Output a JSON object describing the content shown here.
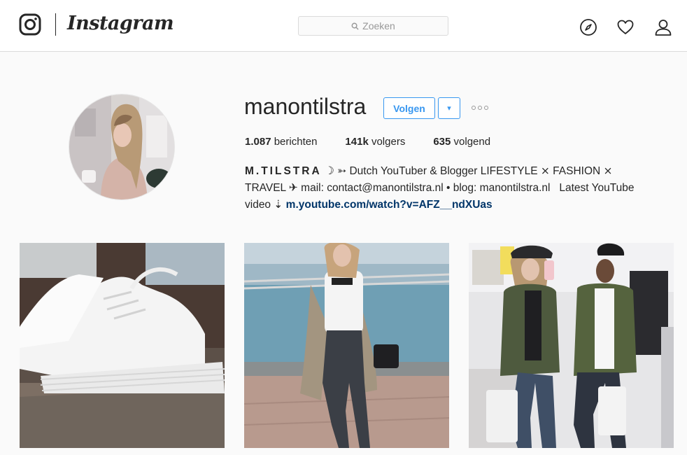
{
  "header": {
    "wordmark": "Instagram",
    "search": {
      "placeholder": "Zoeken"
    },
    "nav": [
      "explore-icon",
      "heart-icon",
      "profile-icon"
    ]
  },
  "profile": {
    "username": "manontilstra",
    "follow_label": "Volgen",
    "dropdown_label": "▾",
    "stats": [
      {
        "value": "1.087",
        "label": " berichten"
      },
      {
        "value": "141k",
        "label": " volgers"
      },
      {
        "value": "635",
        "label": " volgend"
      }
    ],
    "bio": {
      "name": "M.TILSTRA",
      "line1_rest": " ☽ ➳ Dutch YouTuber & Blogger LIFESTYLE ⨯ FASHION ⨯",
      "line2": "TRAVEL ✈ mail: contact@manontilstra.nl • blog: manontilstra.nl   Latest YouTube",
      "line3_prefix": "video ⇣ ",
      "link": "m.youtube.com/watch?v=AFZ__ndXUas"
    }
  },
  "colors": {
    "accent": "#3897f0",
    "link": "#003569",
    "border": "#dbdbdb",
    "background": "#fafafa"
  }
}
